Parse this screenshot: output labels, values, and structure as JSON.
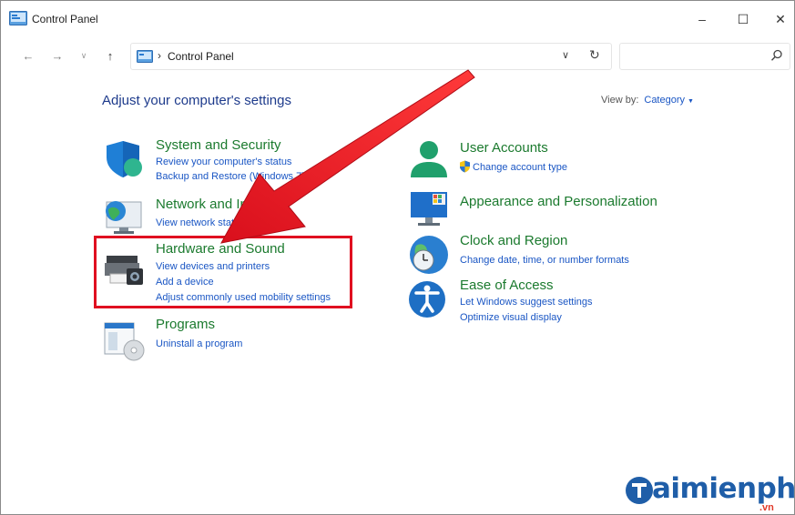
{
  "window": {
    "title": "Control Panel",
    "controls": {
      "minimize": "–",
      "maximize": "☐",
      "close": "✕"
    }
  },
  "address_bar": {
    "back": "←",
    "forward": "→",
    "recent": "∨",
    "up": "↑",
    "separator": "›",
    "path": "Control Panel",
    "dropdown": "∨",
    "refresh": "↻",
    "search_value": "",
    "search_placeholder": ""
  },
  "content": {
    "heading": "Adjust your computer's settings",
    "view_by_label": "View by:",
    "view_by_value": "Category",
    "view_by_caret": "▼"
  },
  "categories_left": [
    {
      "title": "System and Security",
      "icon": "shield-icon",
      "links": [
        "Review your computer's status",
        "Backup and Restore (Windows 7)"
      ]
    },
    {
      "title": "Network and Internet",
      "icon": "network-globe-icon",
      "links": [
        "View network status and tasks"
      ]
    },
    {
      "title": "Hardware and Sound",
      "icon": "printer-icon",
      "links": [
        "View devices and printers",
        "Add a device",
        "Adjust commonly used mobility settings"
      ]
    },
    {
      "title": "Programs",
      "icon": "programs-icon",
      "links": [
        "Uninstall a program"
      ]
    }
  ],
  "categories_right": [
    {
      "title": "User Accounts",
      "icon": "user-icon",
      "links": [
        "Change account type"
      ]
    },
    {
      "title": "Appearance and Personalization",
      "icon": "monitor-icon",
      "links": []
    },
    {
      "title": "Clock and Region",
      "icon": "clock-globe-icon",
      "links": [
        "Change date, time, or number formats"
      ]
    },
    {
      "title": "Ease of Access",
      "icon": "accessibility-icon",
      "links": [
        "Let Windows suggest settings",
        "Optimize visual display"
      ]
    }
  ],
  "watermark": {
    "brand": "aimienphi",
    "tld": ".vn"
  },
  "colors": {
    "category_title": "#1b7a2e",
    "link": "#1a56c4",
    "heading": "#1e3b8c",
    "highlight": "#e01020"
  }
}
